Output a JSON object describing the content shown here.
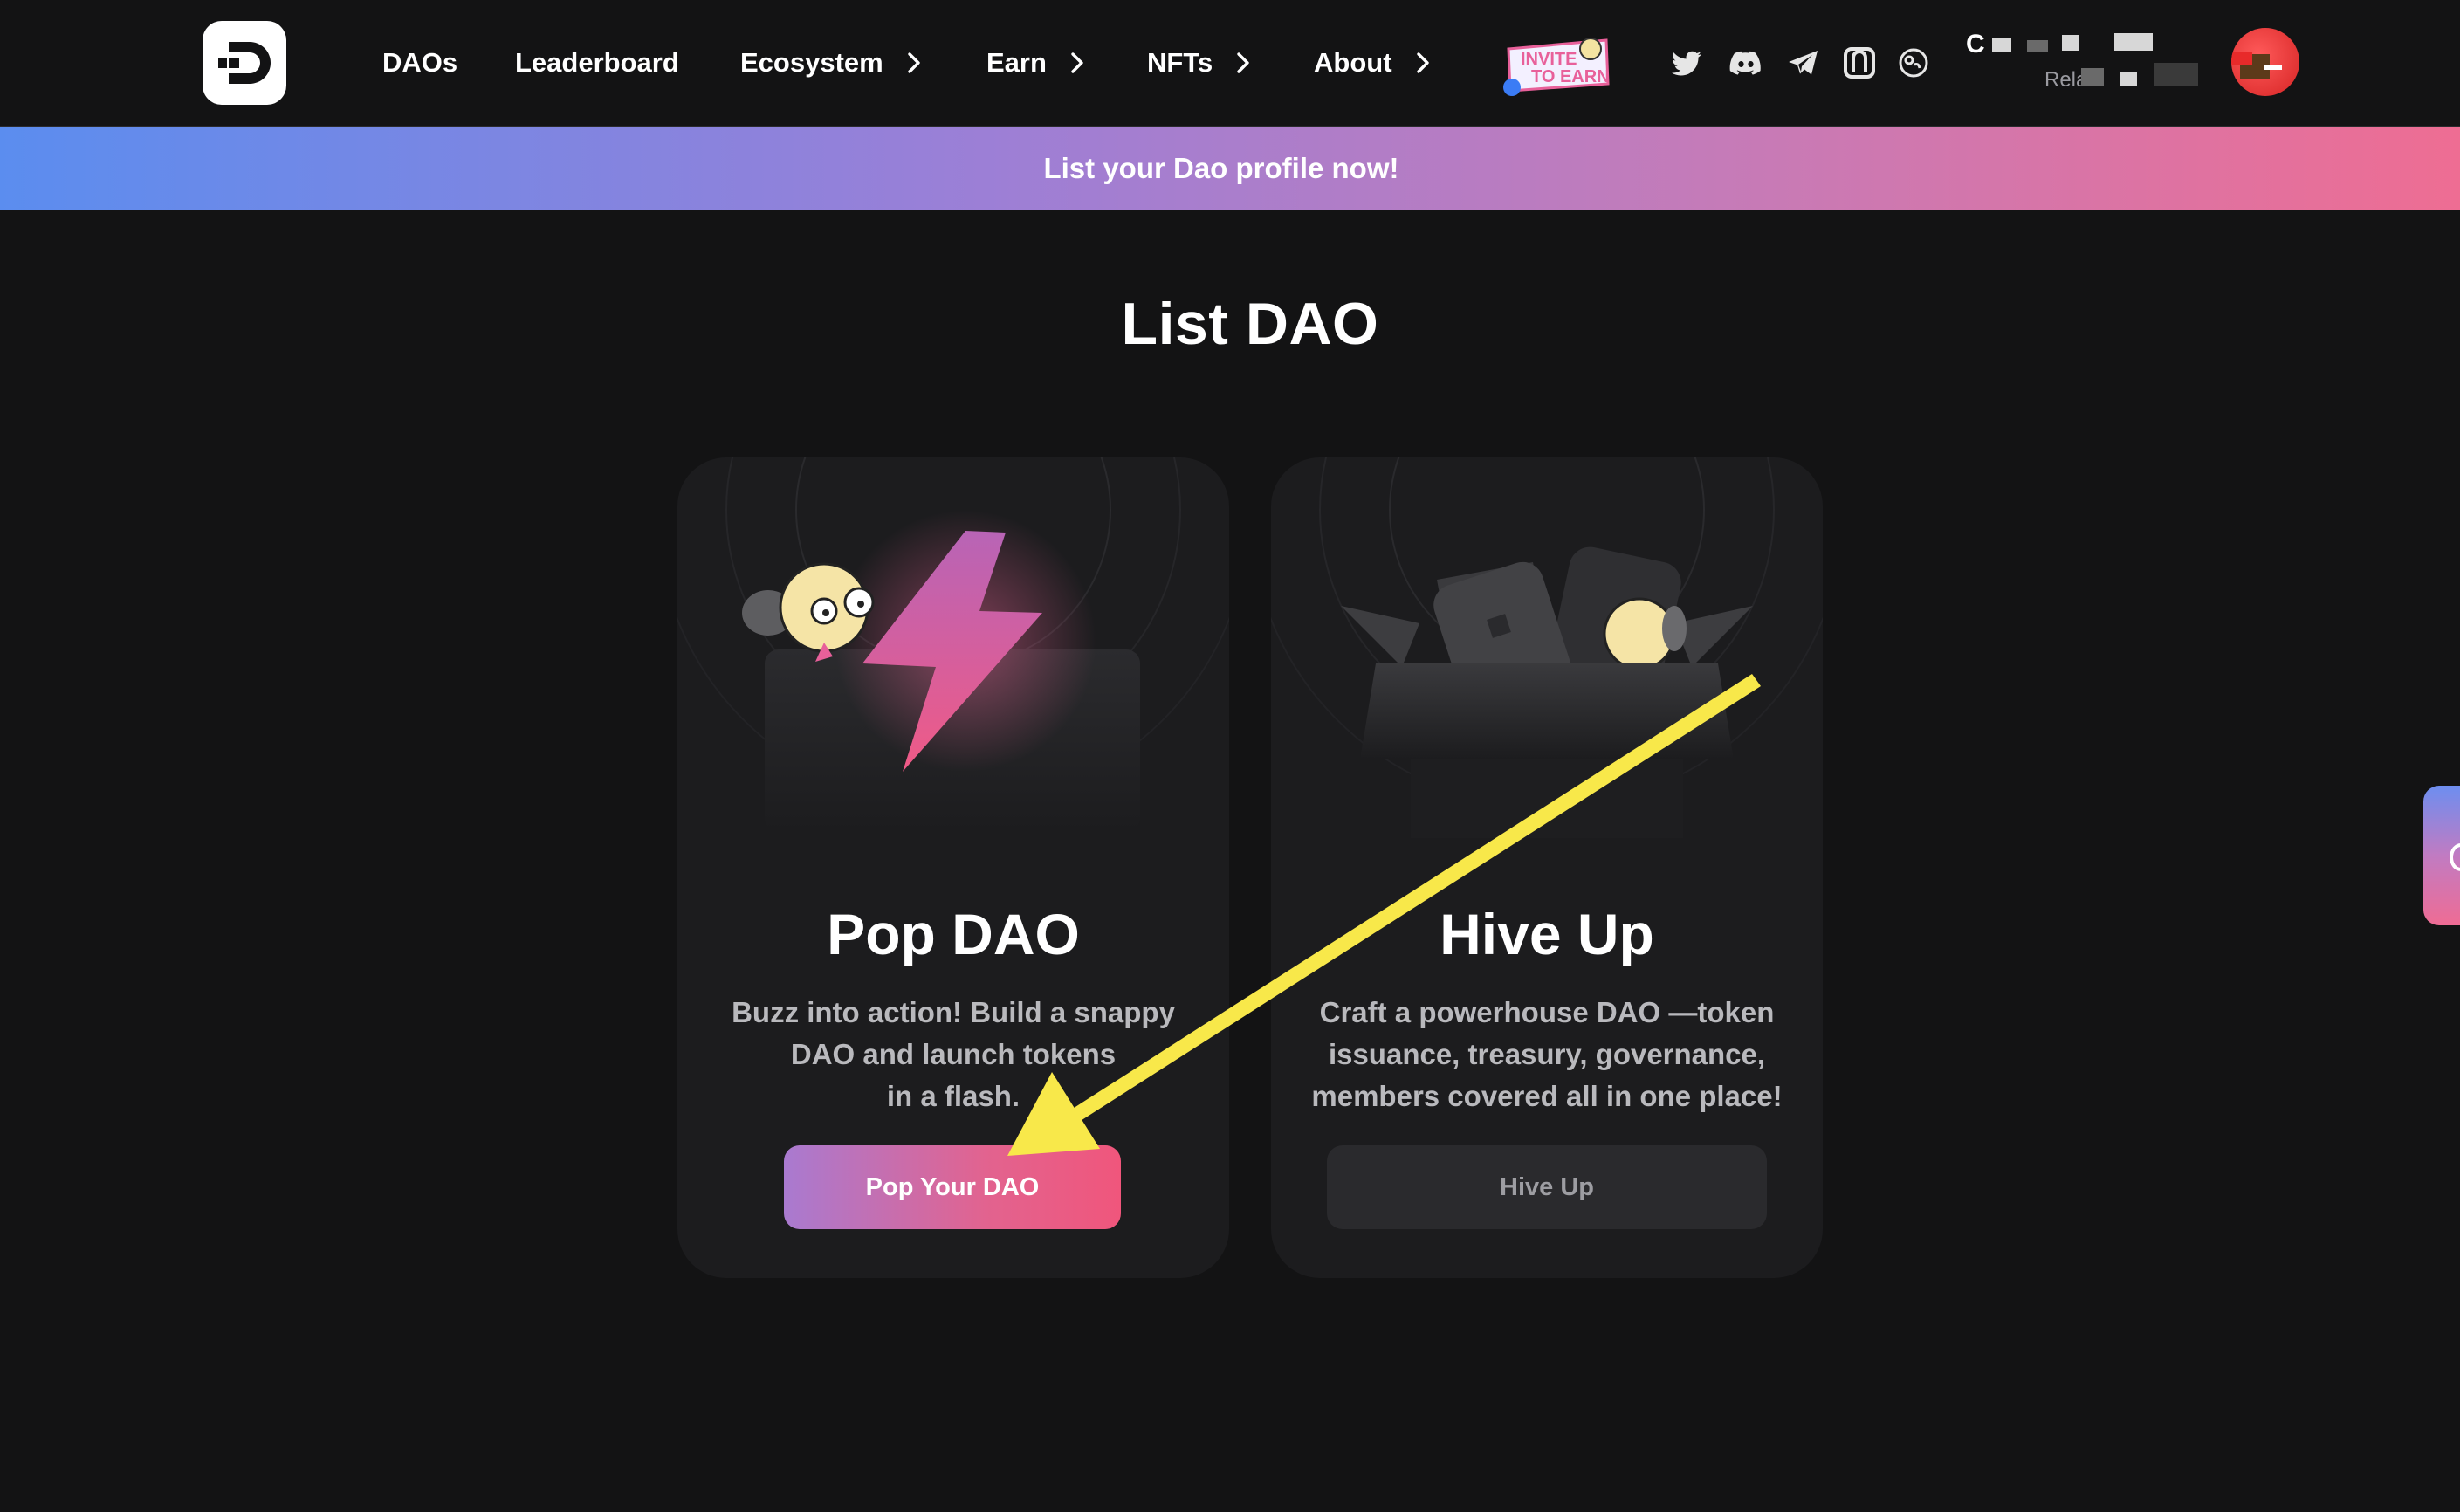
{
  "nav": {
    "logo": "dao-logo",
    "items": [
      {
        "label": "DAOs",
        "has_chevron": false
      },
      {
        "label": "Leaderboard",
        "has_chevron": false
      },
      {
        "label": "Ecosystem",
        "has_chevron": true
      },
      {
        "label": "Earn",
        "has_chevron": true
      },
      {
        "label": "NFTs",
        "has_chevron": true
      },
      {
        "label": "About",
        "has_chevron": true
      }
    ],
    "invite_badge": {
      "line1": "INVITE",
      "line2": "TO EARN"
    },
    "social_icons": [
      "twitter-icon",
      "discord-icon",
      "telegram-icon",
      "gitbook-icon",
      "brain-icon"
    ],
    "wallet": {
      "name": "C",
      "sub": "Rela"
    }
  },
  "banner": {
    "text": "List your Dao profile now!"
  },
  "page": {
    "title": "List DAO"
  },
  "cards": [
    {
      "title": "Pop DAO",
      "description_lines": [
        "Buzz into action! Build a snappy",
        "DAO and launch tokens",
        "in a flash."
      ],
      "button": "Pop Your DAO"
    },
    {
      "title": "Hive Up",
      "description_lines": [
        "Craft a powerhouse DAO —token",
        "issuance, treasury, governance,",
        "members covered all in one place!"
      ],
      "button": "Hive Up"
    }
  ],
  "colors": {
    "background": "#131314",
    "card": "#1c1c1e",
    "accent_pink": "#f0567c",
    "accent_purple": "#a97ad0",
    "arrow": "#f8e84a"
  }
}
